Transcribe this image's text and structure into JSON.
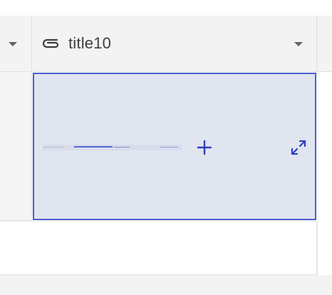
{
  "table": {
    "columns": [
      {
        "title": "",
        "icon": "chevron-down-icon"
      },
      {
        "title": "title10",
        "icon": "attachment-icon",
        "menu_icon": "chevron-down-icon"
      }
    ],
    "selected_cell": {
      "actions": [
        "add-icon",
        "expand-icon"
      ]
    }
  },
  "colors": {
    "header_bg": "#f3f3f3",
    "selected_cell_bg": "#e1e5f0",
    "selected_border": "#4a5fd0",
    "accent": "#2d3fbf"
  }
}
